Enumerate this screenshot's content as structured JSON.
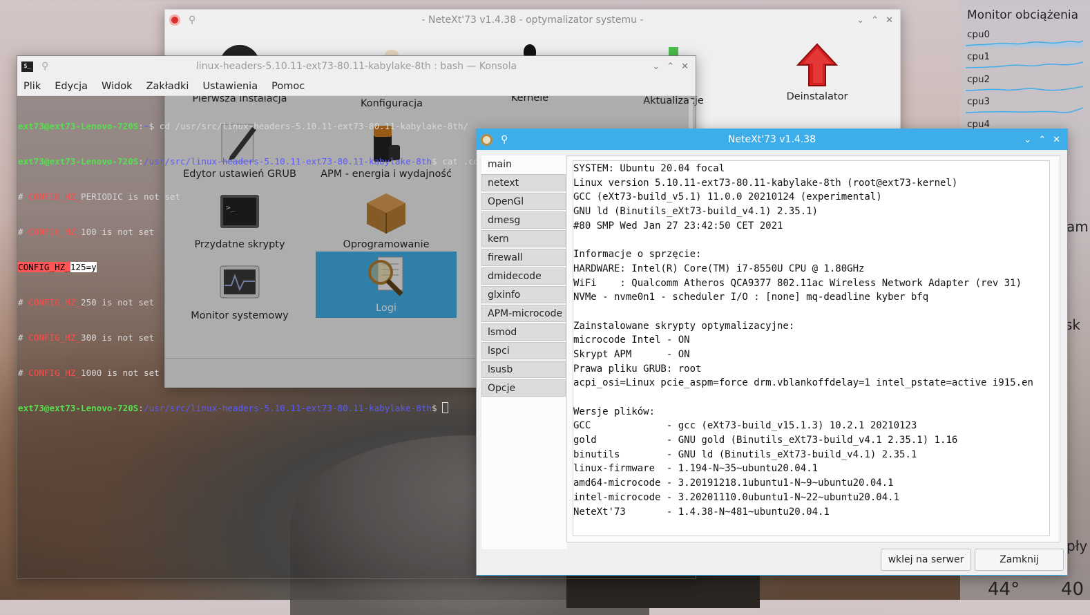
{
  "optimizer": {
    "title": "- NeteXt'73 v1.4.38 - optymalizator systemu -",
    "items": [
      {
        "label": "Pierwsza instalacja",
        "icon": "disc-icon"
      },
      {
        "label": "Konfiguracja",
        "icon": "config-icon"
      },
      {
        "label": "Kernele",
        "icon": "tux-icon"
      },
      {
        "label": "Aktualizacje",
        "icon": "update-icon"
      },
      {
        "label": "Deinstalator",
        "icon": "red-arrow-up-icon"
      },
      {
        "label": "Edytor ustawień GRUB",
        "icon": "pen-icon"
      },
      {
        "label": "APM - energia i wydajność",
        "icon": "battery-icon"
      },
      {
        "label": "Przydatne skrypty",
        "icon": "terminal-icon"
      },
      {
        "label": "Oprogramowanie",
        "icon": "package-icon"
      },
      {
        "label": "Monitor systemowy",
        "icon": "system-monitor-icon"
      },
      {
        "label": "Logi",
        "icon": "magnifier-document-icon"
      }
    ]
  },
  "konsole": {
    "title": "linux-headers-5.10.11-ext73-80.11-kabylake-8th : bash — Konsola",
    "menu": [
      "Plik",
      "Edycja",
      "Widok",
      "Zakładki",
      "Ustawienia",
      "Pomoc"
    ],
    "lines": [
      {
        "prompt": "ext73@ext73-Lenovo-720S",
        "sep": ":",
        "path": "~",
        "cmd": "$ cd /usr/src/linux-headers-5.10.11-ext73-80.11-kabylake-8th/"
      },
      {
        "prompt": "ext73@ext73-Lenovo-720S",
        "sep": ":",
        "path": "/usr/src/linux-headers-5.10.11-ext73-80.11-kabylake-8th",
        "cmd": "$ cat .config | grep CONFIG_HZ_"
      },
      {
        "pre": "# ",
        "match": "CONFIG_HZ_",
        "rest": "PERIODIC is not set"
      },
      {
        "pre": "# ",
        "match": "CONFIG_HZ_",
        "rest": "100 is not set"
      },
      {
        "pre": "",
        "match": "CONFIG_HZ_",
        "rest": "125=y",
        "highlight": true
      },
      {
        "pre": "# ",
        "match": "CONFIG_HZ_",
        "rest": "250 is not set"
      },
      {
        "pre": "# ",
        "match": "CONFIG_HZ_",
        "rest": "300 is not set"
      },
      {
        "pre": "# ",
        "match": "CONFIG_HZ_",
        "rest": "1000 is not set"
      },
      {
        "prompt": "ext73@ext73-Lenovo-720S",
        "sep": ":",
        "path": "/usr/src/linux-headers-5.10.11-ext73-80.11-kabylake-8th",
        "cmd": "$ ",
        "cursor": true
      }
    ]
  },
  "dialog": {
    "title": "NeteXt'73 v1.4.38",
    "tabs": [
      "main",
      "netext",
      "OpenGl",
      "dmesg",
      "kern",
      "firewall",
      "dmidecode",
      "glxinfo",
      "APM-microcode",
      "lsmod",
      "lspci",
      "lsusb",
      "Opcje"
    ],
    "active_tab": "main",
    "content_lines": [
      "SYSTEM: Ubuntu 20.04 focal",
      "Linux version 5.10.11-ext73-80.11-kabylake-8th (root@ext73-kernel)",
      "GCC (eXt73-build_v5.1) 11.0.0 20210124 (experimental)",
      "GNU ld (Binutils_eXt73-build_v4.1) 2.35.1)",
      "#80 SMP Wed Jan 27 23:42:50 CET 2021",
      "",
      "Informacje o sprzęcie:",
      "HARDWARE: Intel(R) Core(TM) i7-8550U CPU @ 1.80GHz",
      "WiFi    : Qualcomm Atheros QCA9377 802.11ac Wireless Network Adapter (rev 31)",
      "NVMe - nvme0n1 - scheduler I/O : [none] mq-deadline kyber bfq",
      "",
      "Zainstalowane skrypty optymalizacyjne:",
      "microcode Intel - ON",
      "Skrypt APM      - ON",
      "Prawa pliku GRUB: root",
      "acpi_osi=Linux pcie_aspm=force drm.vblankoffdelay=1 intel_pstate=active i915.en",
      "",
      "Wersje plików:",
      "GCC             - gcc (eXt73-build_v15.1.3) 10.2.1 20210123",
      "gold            - GNU gold (Binutils_eXt73-build_v4.1 2.35.1) 1.16",
      "binutils        - GNU ld (Binutils_eXt73-build_v4.1) 2.35.1",
      "linux-firmware  - 1.194-N~35~ubuntu20.04.1",
      "amd64-microcode - 3.20191218.1ubuntu1-N~9~ubuntu20.04.1",
      "intel-microcode - 3.20201110.0ubuntu1-N~22~ubuntu20.04.1",
      "NeteXt'73       - 1.4.38-N~481~ubuntu20.04.1"
    ],
    "buttons": {
      "upload": "wklej na serwer",
      "close": "Zamknij"
    }
  },
  "monitor": {
    "title": "Monitor obciążenia",
    "cpus": [
      "cpu0",
      "cpu1",
      "cpu2",
      "cpu3",
      "cpu4"
    ],
    "partial": {
      "a": "am",
      "b": "sk",
      "c": "pły",
      "d": "44°",
      "e": "40"
    }
  },
  "colors": {
    "accent": "#3daee9",
    "prompt_green": "#55e04f",
    "path_blue": "#5a5aff",
    "match_red": "#ff4a4a"
  }
}
